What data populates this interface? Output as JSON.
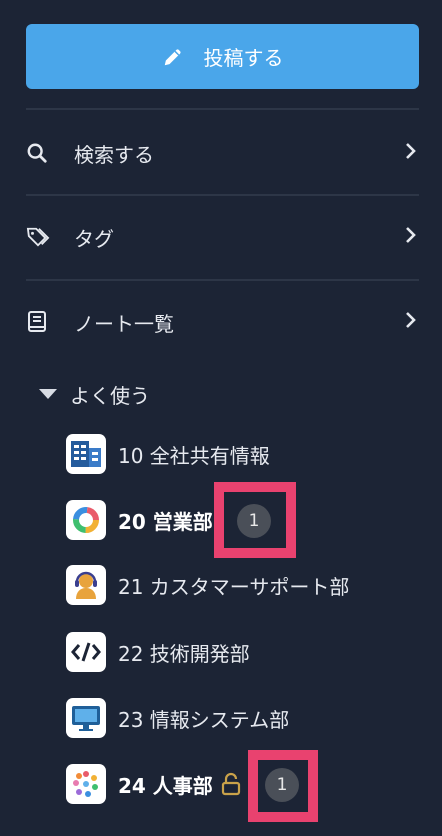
{
  "post_button": {
    "label": "投稿する",
    "icon": "pencil-icon"
  },
  "nav": {
    "search": {
      "label": "検索する",
      "icon": "search-icon"
    },
    "tags": {
      "label": "タグ",
      "icon": "tag-icon"
    },
    "notes": {
      "label": "ノート一覧",
      "icon": "notebook-icon"
    }
  },
  "favorites": {
    "label": "よく使う",
    "items": [
      {
        "label": "10 全社共有情報",
        "icon": "building-icon"
      },
      {
        "label": "20 営業部",
        "icon": "ring-chart-icon",
        "badge": "1"
      },
      {
        "label": "21 カスタマーサポート部",
        "icon": "headset-person-icon"
      },
      {
        "label": "22 技術開発部",
        "icon": "code-icon"
      },
      {
        "label": "23 情報システム部",
        "icon": "monitor-icon"
      },
      {
        "label": "24 人事部",
        "icon": "people-dots-icon",
        "badge": "1",
        "locked": true
      }
    ]
  },
  "colors": {
    "background": "#1c2435",
    "accent": "#4aa6ea",
    "highlight": "#e9426f"
  }
}
